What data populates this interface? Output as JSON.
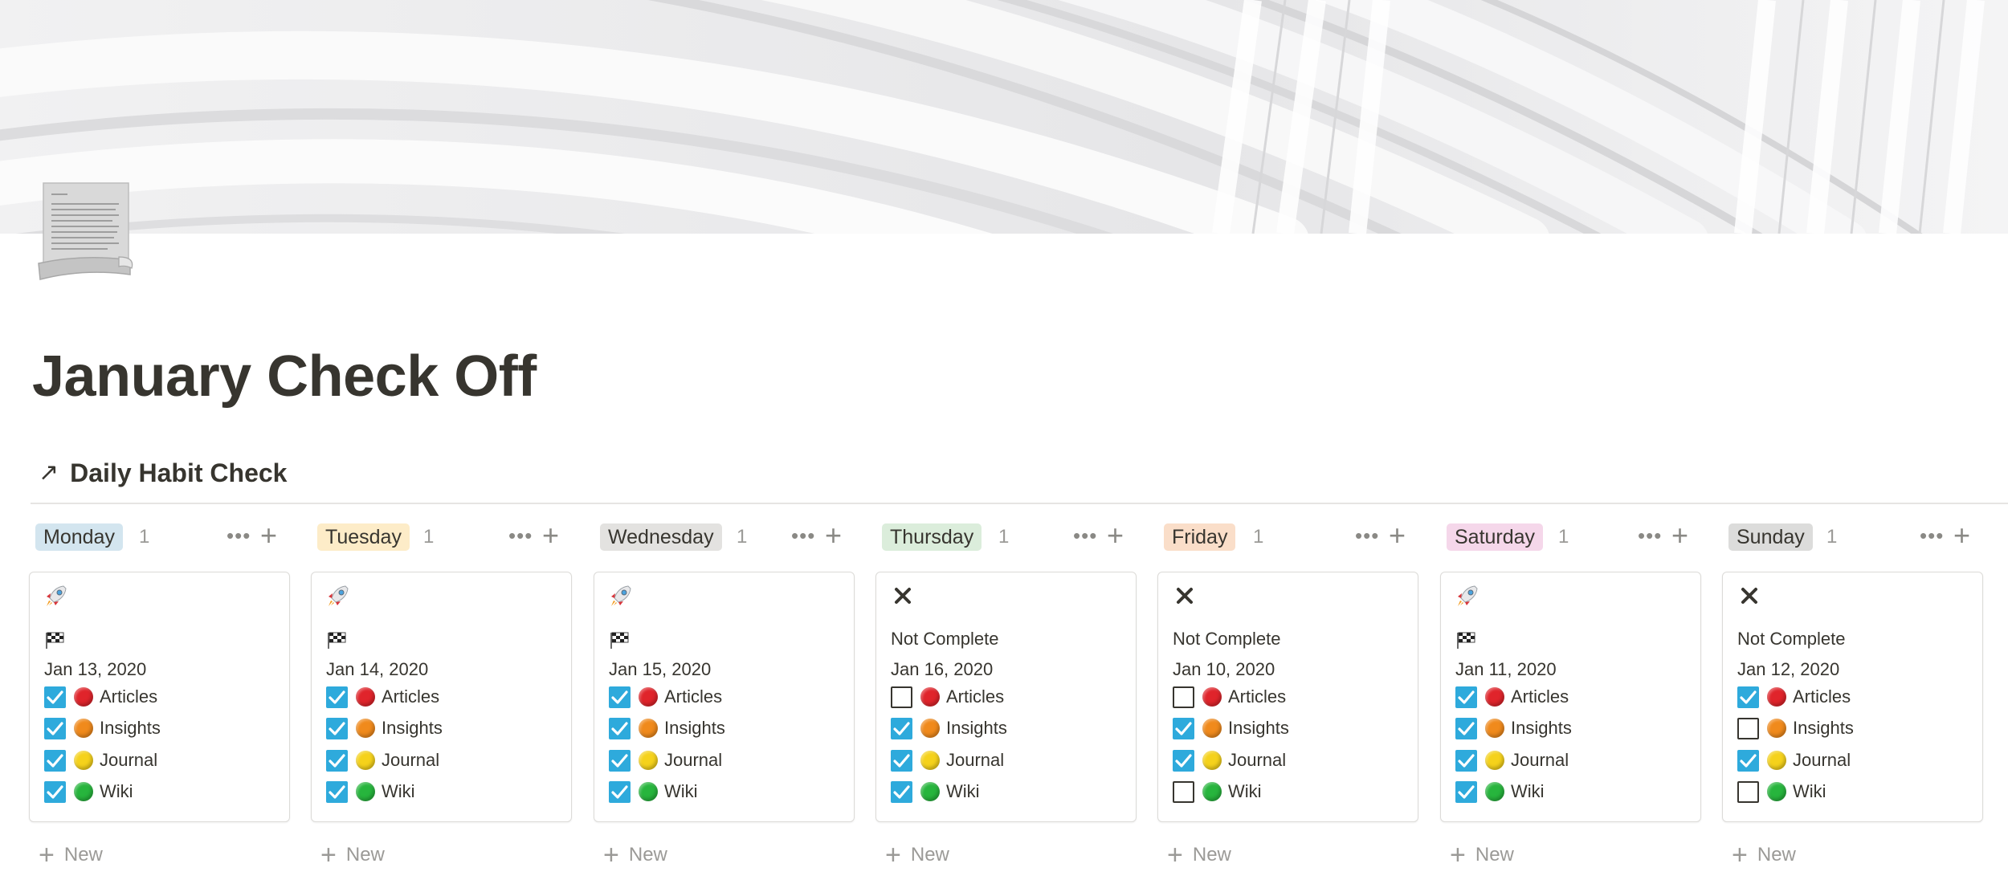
{
  "page": {
    "title": "January Check Off",
    "cover": "white-curved-architecture-cover",
    "icon": "paper-scroll-icon"
  },
  "database": {
    "link_icon": "↗",
    "title": "Daily Habit Check"
  },
  "habits": [
    {
      "label": "Articles",
      "color": "#e0242b"
    },
    {
      "label": "Insights",
      "color": "#f08a1c"
    },
    {
      "label": "Journal",
      "color": "#f5d21b"
    },
    {
      "label": "Wiki",
      "color": "#27b53d"
    }
  ],
  "toggle_on_color": "#2eaadc",
  "columns": [
    {
      "day": "Monday",
      "tag_color": "#d3e5ef",
      "count": "1",
      "card": {
        "icon": "rocket-icon",
        "name": "🏁",
        "status": "flag",
        "date": "Jan 13, 2020",
        "checks": [
          true,
          true,
          true,
          true
        ]
      }
    },
    {
      "day": "Tuesday",
      "tag_color": "#fdecc8",
      "count": "1",
      "card": {
        "icon": "rocket-icon",
        "name": "🏁",
        "status": "flag",
        "date": "Jan 14, 2020",
        "checks": [
          true,
          true,
          true,
          true
        ]
      }
    },
    {
      "day": "Wednesday",
      "tag_color": "#e3e2e0",
      "count": "1",
      "card": {
        "icon": "rocket-icon",
        "name": "🏁",
        "status": "flag",
        "date": "Jan 15, 2020",
        "checks": [
          true,
          true,
          true,
          true
        ]
      }
    },
    {
      "day": "Thursday",
      "tag_color": "#dbeddb",
      "count": "1",
      "card": {
        "icon": "cross-icon",
        "name": "Not Complete",
        "status": "text",
        "date": "Jan 16, 2020",
        "checks": [
          false,
          true,
          true,
          true
        ]
      }
    },
    {
      "day": "Friday",
      "tag_color": "#fadec9",
      "count": "1",
      "card": {
        "icon": "cross-icon",
        "name": "Not Complete",
        "status": "text",
        "date": "Jan 10, 2020",
        "checks": [
          false,
          true,
          true,
          false
        ]
      }
    },
    {
      "day": "Saturday",
      "tag_color": "#f5d7ea",
      "count": "1",
      "card": {
        "icon": "rocket-icon",
        "name": "🏁",
        "status": "flag",
        "date": "Jan 11, 2020",
        "checks": [
          true,
          true,
          true,
          true
        ]
      }
    },
    {
      "day": "Sunday",
      "tag_color": "#dcdcdb",
      "count": "1",
      "card": {
        "icon": "cross-icon",
        "name": "Not Complete",
        "status": "text",
        "date": "Jan 12, 2020",
        "checks": [
          true,
          false,
          true,
          false
        ]
      }
    }
  ],
  "column_actions": {
    "more": "•••",
    "add": "+"
  },
  "new_item": {
    "plus": "+",
    "label": "New"
  }
}
